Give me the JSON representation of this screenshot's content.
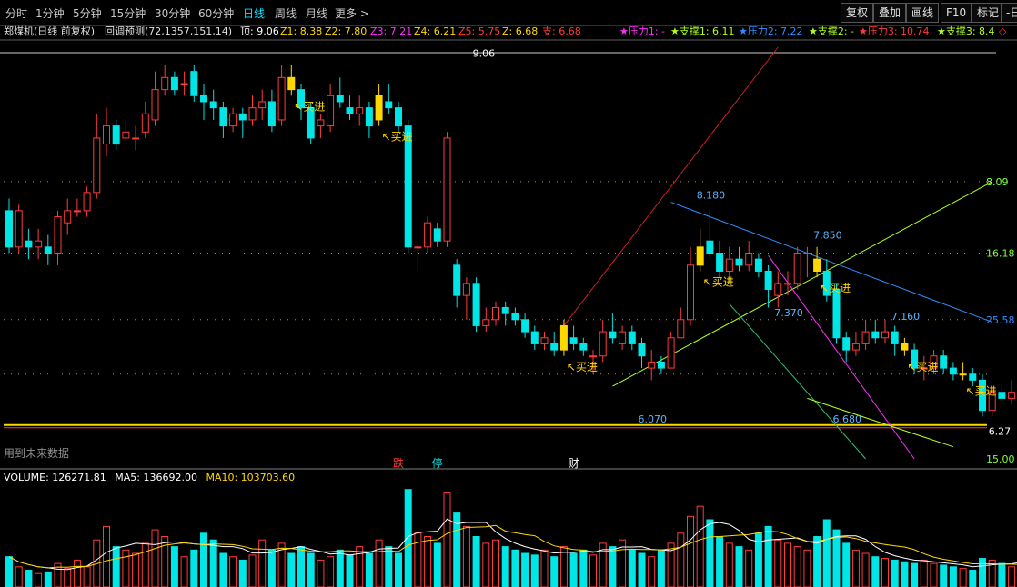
{
  "toolbar": {
    "periods": [
      "分时",
      "1分钟",
      "5分钟",
      "15分钟",
      "30分钟",
      "60分钟",
      "日线",
      "周线",
      "月线",
      "更多 >"
    ],
    "active_period": "日线",
    "right_buttons": [
      "复权",
      "叠加",
      "画线",
      "F10",
      "标记",
      "-日"
    ]
  },
  "infobar": {
    "stock": "郑煤机(日线 前复权)",
    "indicator": "回调预测(72,1357,151,14)",
    "top": "顶: 9.06",
    "z1": "Z1: 8.38",
    "z2": "Z2: 7.80",
    "z3": "Z3: 7.21",
    "z4": "Z4: 6.21",
    "z5": "Z5: 5.75",
    "z": "Z: 6.68",
    "support": "支: 6.68",
    "pressure1": "★压力1: -",
    "support1": "★支撑1: 6.11",
    "pressure2": "★压力2: 7.22",
    "support2": "★支撑2: -",
    "pressure3": "★压力3: 10.74",
    "support3": "★支撑3: 8.4",
    "end_mark": "◇"
  },
  "colors": {
    "up": "#ff3b3b",
    "down": "#00e5e5",
    "signal": "#ffd700",
    "ma5": "#ffffff",
    "ma10": "#ffd700",
    "dotted": "#b89030",
    "trend_red": "#d02020",
    "trend_blue": "#2f8fff",
    "trend_green": "#b0ff20",
    "trend_magenta": "#ff30ff",
    "trend_teal": "#30c070",
    "hline": "#ffd700"
  },
  "chart_data": {
    "type": "candlestick",
    "price_ylim": [
      5.8,
      9.2
    ],
    "volume_ylim": [
      0,
      300000
    ],
    "candles": [
      [
        7.85,
        7.55,
        7.95,
        7.5
      ],
      [
        7.55,
        7.85,
        7.9,
        7.5
      ],
      [
        7.6,
        7.55,
        7.7,
        7.45
      ],
      [
        7.55,
        7.6,
        7.7,
        7.45
      ],
      [
        7.55,
        7.5,
        7.65,
        7.4
      ],
      [
        7.5,
        7.8,
        7.85,
        7.4
      ],
      [
        7.75,
        7.85,
        7.95,
        7.65
      ],
      [
        7.85,
        7.85,
        7.95,
        7.8
      ],
      [
        7.85,
        8.0,
        8.05,
        7.8
      ],
      [
        8.0,
        8.45,
        8.65,
        7.95
      ],
      [
        8.4,
        8.55,
        8.7,
        8.3
      ],
      [
        8.55,
        8.4,
        8.6,
        8.35
      ],
      [
        8.45,
        8.5,
        8.6,
        8.4
      ],
      [
        8.45,
        8.45,
        8.55,
        8.35
      ],
      [
        8.5,
        8.65,
        8.75,
        8.45
      ],
      [
        8.6,
        8.85,
        9.0,
        8.55
      ],
      [
        8.85,
        8.95,
        9.05,
        8.8
      ],
      [
        8.95,
        8.85,
        9.0,
        8.8
      ],
      [
        8.9,
        8.9,
        9.0,
        8.8
      ],
      [
        9.0,
        8.8,
        9.05,
        8.75
      ],
      [
        8.8,
        8.75,
        8.9,
        8.6
      ],
      [
        8.75,
        8.7,
        8.85,
        8.6
      ],
      [
        8.7,
        8.55,
        8.75,
        8.45
      ],
      [
        8.55,
        8.65,
        8.7,
        8.5
      ],
      [
        8.65,
        8.6,
        8.7,
        8.45
      ],
      [
        8.6,
        8.7,
        8.8,
        8.55
      ],
      [
        8.7,
        8.75,
        8.85,
        8.6
      ],
      [
        8.75,
        8.55,
        8.85,
        8.5
      ],
      [
        8.6,
        8.95,
        9.05,
        8.55
      ],
      [
        8.95,
        8.85,
        9.05,
        8.8
      ],
      [
        8.85,
        8.7,
        8.9,
        8.6
      ],
      [
        8.7,
        8.45,
        8.75,
        8.4
      ],
      [
        8.55,
        8.6,
        8.65,
        8.45
      ],
      [
        8.55,
        8.8,
        8.9,
        8.5
      ],
      [
        8.8,
        8.75,
        8.95,
        8.7
      ],
      [
        8.7,
        8.65,
        8.8,
        8.6
      ],
      [
        8.65,
        8.7,
        8.8,
        8.55
      ],
      [
        8.7,
        8.55,
        8.75,
        8.45
      ],
      [
        8.6,
        8.8,
        8.9,
        8.55
      ],
      [
        8.75,
        8.7,
        8.9,
        8.65
      ],
      [
        8.7,
        8.55,
        8.75,
        8.5
      ],
      [
        8.55,
        7.55,
        8.6,
        7.5
      ],
      [
        7.55,
        7.55,
        7.6,
        7.35
      ],
      [
        7.55,
        7.75,
        7.8,
        7.5
      ],
      [
        7.7,
        7.6,
        7.75,
        7.55
      ],
      [
        7.6,
        8.45,
        8.5,
        7.55
      ],
      [
        7.4,
        7.15,
        7.45,
        7.05
      ],
      [
        7.15,
        7.25,
        7.3,
        6.95
      ],
      [
        7.25,
        6.9,
        7.3,
        6.85
      ],
      [
        6.9,
        6.95,
        7.05,
        6.85
      ],
      [
        6.95,
        7.05,
        7.1,
        6.9
      ],
      [
        7.05,
        7.0,
        7.1,
        6.9
      ],
      [
        7.0,
        6.95,
        7.05,
        6.9
      ],
      [
        6.95,
        6.85,
        7.0,
        6.8
      ],
      [
        6.85,
        6.75,
        6.9,
        6.7
      ],
      [
        6.75,
        6.8,
        6.85,
        6.7
      ],
      [
        6.75,
        6.7,
        6.85,
        6.65
      ],
      [
        6.7,
        6.9,
        6.95,
        6.65
      ],
      [
        6.8,
        6.75,
        6.9,
        6.7
      ],
      [
        6.75,
        6.7,
        6.8,
        6.65
      ],
      [
        6.65,
        6.65,
        6.7,
        6.5
      ],
      [
        6.65,
        6.85,
        6.95,
        6.6
      ],
      [
        6.85,
        6.8,
        7.0,
        6.75
      ],
      [
        6.75,
        6.85,
        6.9,
        6.7
      ],
      [
        6.85,
        6.75,
        6.9,
        6.7
      ],
      [
        6.75,
        6.65,
        6.8,
        6.55
      ],
      [
        6.55,
        6.6,
        6.7,
        6.45
      ],
      [
        6.6,
        6.55,
        6.65,
        6.5
      ],
      [
        6.55,
        6.8,
        6.85,
        6.55
      ],
      [
        6.8,
        6.95,
        7.05,
        6.8
      ],
      [
        6.95,
        7.4,
        7.55,
        6.9
      ],
      [
        7.4,
        7.55,
        7.7,
        7.35
      ],
      [
        7.6,
        7.5,
        7.85,
        7.45
      ],
      [
        7.5,
        7.35,
        7.6,
        7.3
      ],
      [
        7.35,
        7.45,
        7.55,
        7.25
      ],
      [
        7.45,
        7.4,
        7.55,
        7.35
      ],
      [
        7.4,
        7.5,
        7.6,
        7.35
      ],
      [
        7.45,
        7.35,
        7.5,
        7.3
      ],
      [
        7.35,
        7.2,
        7.4,
        7.05
      ],
      [
        7.15,
        7.25,
        7.35,
        7.05
      ],
      [
        7.25,
        7.25,
        7.35,
        7.15
      ],
      [
        7.25,
        7.5,
        7.55,
        7.2
      ],
      [
        7.5,
        7.5,
        7.55,
        7.3
      ],
      [
        7.45,
        7.35,
        7.55,
        7.3
      ],
      [
        7.35,
        7.15,
        7.45,
        7.1
      ],
      [
        7.2,
        6.8,
        7.25,
        6.75
      ],
      [
        6.8,
        6.7,
        6.85,
        6.6
      ],
      [
        6.7,
        6.75,
        6.85,
        6.65
      ],
      [
        6.75,
        6.85,
        6.95,
        6.7
      ],
      [
        6.85,
        6.8,
        6.95,
        6.75
      ],
      [
        6.8,
        6.85,
        6.95,
        6.75
      ],
      [
        6.85,
        6.75,
        6.9,
        6.65
      ],
      [
        6.75,
        6.7,
        6.8,
        6.65
      ],
      [
        6.7,
        6.55,
        6.75,
        6.5
      ],
      [
        6.55,
        6.55,
        6.65,
        6.45
      ],
      [
        6.55,
        6.65,
        6.7,
        6.5
      ],
      [
        6.65,
        6.55,
        6.7,
        6.5
      ],
      [
        6.55,
        6.5,
        6.6,
        6.45
      ],
      [
        6.5,
        6.5,
        6.6,
        6.45
      ],
      [
        6.5,
        6.45,
        6.55,
        6.4
      ],
      [
        6.45,
        6.2,
        6.5,
        6.15
      ],
      [
        6.2,
        6.35,
        6.4,
        6.15
      ],
      [
        6.35,
        6.3,
        6.4,
        6.25
      ],
      [
        6.3,
        6.35,
        6.45,
        6.25
      ],
      [
        6.35,
        6.45,
        6.5,
        6.3
      ]
    ],
    "signal_candles": [
      29,
      38,
      57,
      71,
      83,
      92,
      98
    ],
    "buy_signals": [
      29,
      38,
      57,
      71,
      83,
      92,
      98
    ],
    "buy_label": "买进",
    "volumes": [
      90000,
      60000,
      50000,
      40000,
      45000,
      70000,
      55000,
      80000,
      60000,
      140000,
      180000,
      120000,
      110000,
      100000,
      130000,
      170000,
      150000,
      120000,
      90000,
      110000,
      160000,
      140000,
      100000,
      90000,
      80000,
      95000,
      140000,
      110000,
      130000,
      100000,
      120000,
      100000,
      80000,
      90000,
      110000,
      95000,
      120000,
      100000,
      140000,
      120000,
      100000,
      290000,
      160000,
      150000,
      130000,
      280000,
      220000,
      180000,
      150000,
      130000,
      140000,
      120000,
      110000,
      100000,
      95000,
      110000,
      90000,
      120000,
      100000,
      110000,
      95000,
      130000,
      120000,
      140000,
      110000,
      100000,
      90000,
      110000,
      130000,
      160000,
      210000,
      240000,
      200000,
      150000,
      130000,
      120000,
      110000,
      160000,
      180000,
      140000,
      130000,
      120000,
      110000,
      150000,
      200000,
      170000,
      130000,
      110000,
      100000,
      90000,
      85000,
      80000,
      75000,
      70000,
      80000,
      70000,
      65000,
      60000,
      55000,
      50000,
      85000,
      80000,
      70000,
      60000,
      75000
    ],
    "volume_legend": {
      "volume": "VOLUME: 126271.81",
      "ma5": "MA5: 136692.00",
      "ma10": "MA10: 103703.60"
    },
    "dotted_levels": [
      8.09,
      7.5,
      6.95,
      6.5
    ],
    "right_labels": [
      {
        "price": 8.09,
        "text": "8.09",
        "color": "#80ff40"
      },
      {
        "price": 7.5,
        "text": "16.18",
        "color": "#80ff40"
      },
      {
        "price": 6.95,
        "text": "25.58",
        "color": "#2f8fff"
      },
      {
        "price": 5.8,
        "text": "15.00",
        "color": "#80ff40"
      }
    ],
    "horizontal_line": 6.08,
    "annotations": [
      {
        "text": "9.06",
        "bar": 48,
        "price": 9.12,
        "color": "#ffffff"
      },
      {
        "text": "8.180",
        "bar": 71,
        "price": 7.95,
        "color": "#5ab4ff"
      },
      {
        "text": "7.850",
        "bar": 83,
        "price": 7.62,
        "color": "#5ab4ff"
      },
      {
        "text": "7.370",
        "bar": 79,
        "price": 6.98,
        "color": "#5ab4ff"
      },
      {
        "text": "7.160",
        "bar": 91,
        "price": 6.95,
        "color": "#5ab4ff"
      },
      {
        "text": "6.070",
        "bar": 65,
        "price": 6.1,
        "color": "#5ab4ff"
      },
      {
        "text": "6.680",
        "bar": 85,
        "price": 6.1,
        "color": "#5ab4ff"
      },
      {
        "text": "6.27",
        "bar": 101,
        "price": 6.0,
        "color": "#ffffff"
      }
    ],
    "event_markers": [
      {
        "text": "跌",
        "bar": 40,
        "color": "#ff3b3b"
      },
      {
        "text": "停",
        "bar": 44,
        "color": "#00e5e5"
      },
      {
        "text": "财",
        "bar": 58,
        "color": "#ffffff"
      }
    ],
    "future_data_note": "用到未来数据"
  }
}
